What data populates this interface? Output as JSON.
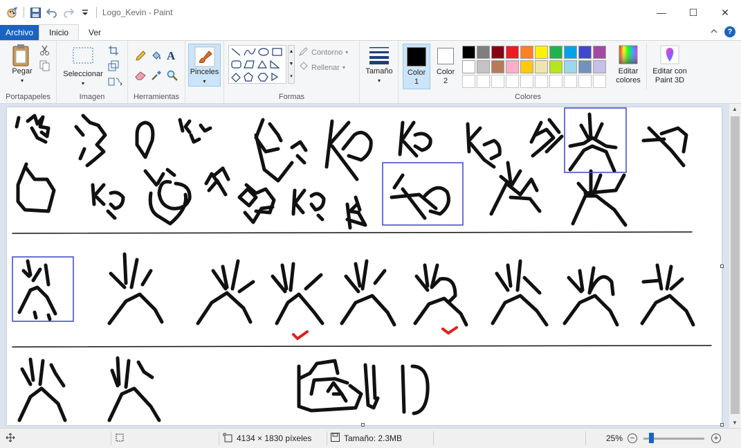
{
  "window": {
    "title": "Logo_Kevin - Paint",
    "minimize": "—",
    "maximize": "☐",
    "close": "✕"
  },
  "tabs": {
    "file": "Archivo",
    "home": "Inicio",
    "view": "Ver"
  },
  "ribbon": {
    "clipboard": {
      "label": "Portapapeles",
      "paste": "Pegar"
    },
    "image": {
      "label": "Imagen",
      "select": "Seleccionar"
    },
    "tools": {
      "label": "Herramientas"
    },
    "brushes": {
      "label": "Pinceles"
    },
    "shapes": {
      "label": "Formas",
      "outline": "Contorno",
      "fill": "Rellenar"
    },
    "size": {
      "label": "Tamaño"
    },
    "colors": {
      "label": "Colores",
      "color1_line1": "Color",
      "color1_line2": "1",
      "color2_line1": "Color",
      "color2_line2": "2",
      "edit_line1": "Editar",
      "edit_line2": "colores",
      "paint3d_line1": "Editar con",
      "paint3d_line2": "Paint 3D",
      "color1_value": "#000000",
      "color2_value": "#ffffff",
      "palette": [
        "#000000",
        "#7f7f7f",
        "#880015",
        "#ed1c24",
        "#ff7f27",
        "#fff200",
        "#22b14c",
        "#00a2e8",
        "#3f48cc",
        "#a349a4",
        "#ffffff",
        "#c3c3c3",
        "#b97a57",
        "#ffaec9",
        "#ffc90e",
        "#efe4b0",
        "#b5e61d",
        "#99d9ea",
        "#7092be",
        "#c8bfe7",
        "#ffffff",
        "#ffffff",
        "#ffffff",
        "#ffffff",
        "#ffffff",
        "#ffffff",
        "#ffffff",
        "#ffffff",
        "#ffffff",
        "#ffffff"
      ]
    }
  },
  "status": {
    "dimensions": "4134 × 1830 píxeles",
    "size": "Tamaño: 2.3MB",
    "zoom": "25%"
  },
  "accent": "#1a64c0"
}
